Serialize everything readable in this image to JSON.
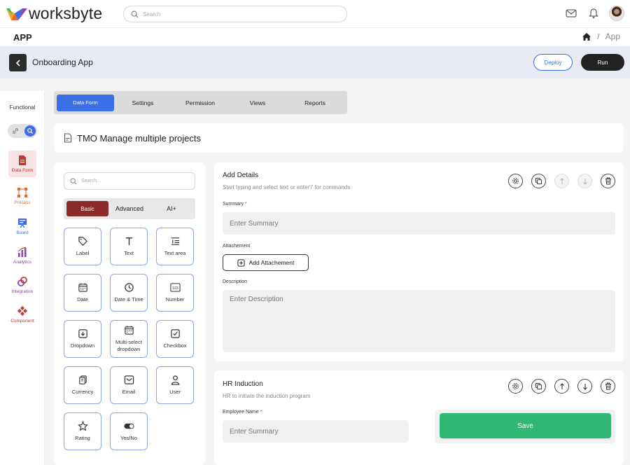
{
  "brand": {
    "name": "worksbyte"
  },
  "topbar": {
    "search_placeholder": "Search",
    "icons": [
      "mail-icon",
      "bell-icon",
      "user-avatar"
    ]
  },
  "app_header": {
    "title": "APP",
    "breadcrumb": [
      "home-icon",
      "App"
    ],
    "breadcrumb_sep": "/"
  },
  "sub_header": {
    "app_title": "Onboarding App",
    "deploy_label": "Deploy",
    "run_label": "Run"
  },
  "rail": {
    "mode_label": "Functional",
    "items": [
      {
        "label": "Data Form",
        "icon": "document-icon",
        "color": "#c0392b",
        "active": true
      },
      {
        "label": "Process",
        "icon": "process-icon",
        "color": "#e8692c"
      },
      {
        "label": "Board",
        "icon": "board-icon",
        "color": "#3b6fe8"
      },
      {
        "label": "Analytics",
        "icon": "analytics-icon",
        "color": "#8e44ad"
      },
      {
        "label": "Integration",
        "icon": "integration-icon",
        "color": "#8e44ad"
      },
      {
        "label": "Component",
        "icon": "component-icon",
        "color": "#c0392b"
      }
    ]
  },
  "tabs": [
    "Data Form",
    "Settings",
    "Permission",
    "Views",
    "Reports"
  ],
  "form_title": "TMO Manage multiple projects",
  "palette": {
    "search_placeholder": "Search...",
    "tabs": [
      "Basic",
      "Advanced",
      "AI+"
    ],
    "tiles": [
      {
        "label": "Label",
        "icon": "tag-icon"
      },
      {
        "label": "Text",
        "icon": "text-icon"
      },
      {
        "label": "Text area",
        "icon": "textarea-icon"
      },
      {
        "label": "Date",
        "icon": "calendar-icon"
      },
      {
        "label": "Date & Time",
        "icon": "clock-icon"
      },
      {
        "label": "Number",
        "icon": "number-icon"
      },
      {
        "label": "Dropdown",
        "icon": "dropdown-icon"
      },
      {
        "label": "Multi-select dropdown",
        "icon": "calendar-icon"
      },
      {
        "label": "Checkbox",
        "icon": "checkbox-icon"
      },
      {
        "label": "Currency",
        "icon": "currency-icon"
      },
      {
        "label": "Email",
        "icon": "email-icon"
      },
      {
        "label": "User",
        "icon": "user-icon"
      },
      {
        "label": "Rating",
        "icon": "star-icon"
      },
      {
        "label": "Yes/No",
        "icon": "toggle-icon"
      }
    ]
  },
  "section1": {
    "title": "Add Details",
    "hint": "Start typing and select text or enter'/' for commands",
    "summary_label": "Summary",
    "summary_placeholder": "Enter Summary",
    "attachment_label": "Attachement",
    "attach_button": "Add Attachement",
    "description_label": "Description",
    "description_placeholder": "Enter Description"
  },
  "section2": {
    "title": "HR Induction",
    "hint": "HR to initiate the induction program",
    "employee_label": "Employee Name",
    "employee_placeholder": "Enter Summary",
    "save_label": "Save"
  },
  "required_mark": "*"
}
